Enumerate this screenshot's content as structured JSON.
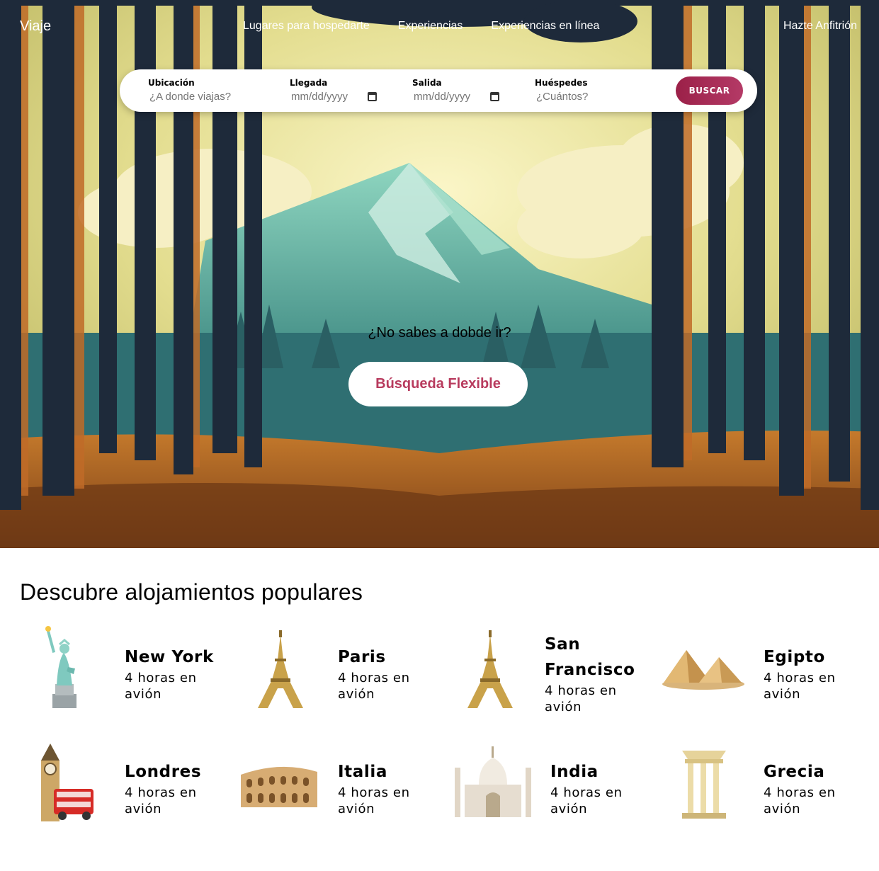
{
  "nav": {
    "brand": "Viaje",
    "links": [
      "Lugares para hospedarte",
      "Experiencias",
      "Experiencias en línea"
    ],
    "host": "Hazte Anfitrión"
  },
  "search": {
    "location_label": "Ubicación",
    "location_placeholder": "¿A donde viajas?",
    "arrival_label": "Llegada",
    "arrival_placeholder": "mm/dd/yyyy",
    "departure_label": "Salida",
    "departure_placeholder": "mm/dd/yyyy",
    "guests_label": "Huéspedes",
    "guests_placeholder": "¿Cuántos?",
    "button": "BUSCAR"
  },
  "hero": {
    "question": "¿No sabes a dobde ir?",
    "flexible_button": "Búsqueda Flexible"
  },
  "popular": {
    "title": "Descubre alojamientos populares",
    "destinations": [
      {
        "name": "New York",
        "time": "4 horas en avión",
        "icon": "statue-of-liberty-icon"
      },
      {
        "name": "Paris",
        "time": "4 horas en avión",
        "icon": "eiffel-tower-icon"
      },
      {
        "name": "San Francisco",
        "time": "4 horas en avión",
        "icon": "eiffel-tower-icon"
      },
      {
        "name": "Egipto",
        "time": "4 horas en avión",
        "icon": "pyramids-icon"
      },
      {
        "name": "Londres",
        "time": "4 horas en avión",
        "icon": "big-ben-bus-icon"
      },
      {
        "name": "Italia",
        "time": "4 horas en avión",
        "icon": "colosseum-icon"
      },
      {
        "name": "India",
        "time": "4 horas en avión",
        "icon": "taj-mahal-icon"
      },
      {
        "name": "Grecia",
        "time": "4 horas en avión",
        "icon": "greek-temple-icon"
      }
    ]
  },
  "colors": {
    "accent": "#a82a55",
    "flex_text": "#b83b5e",
    "sky": "#e8e6a8",
    "mountain": "#5fae9a",
    "ground": "#a5571f",
    "trunks": "#1e2a3a"
  }
}
